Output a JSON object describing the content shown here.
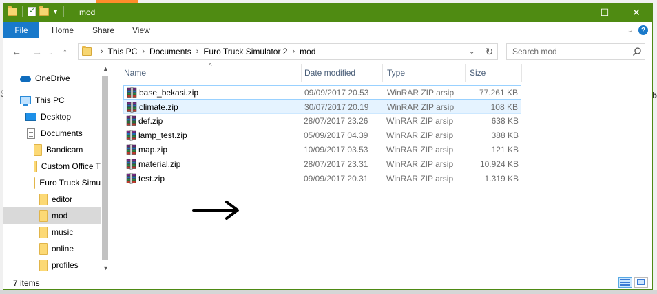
{
  "window": {
    "title": "mod"
  },
  "title_controls": {
    "minimize": "—",
    "maximize": "☐",
    "close": "✕"
  },
  "ribbon": {
    "file": "File",
    "tabs": [
      "Home",
      "Share",
      "View"
    ]
  },
  "nav": {
    "back": "←",
    "forward": "→",
    "up": "↑",
    "breadcrumb": [
      "This PC",
      "Documents",
      "Euro Truck Simulator 2",
      "mod"
    ],
    "refresh": "↻"
  },
  "search": {
    "placeholder": "Search mod"
  },
  "sidebar": {
    "items": [
      {
        "label": "OneDrive",
        "icon": "onedrive-icon"
      },
      {
        "label": "This PC",
        "icon": "computer-icon"
      },
      {
        "label": "Desktop",
        "icon": "desktop-icon"
      },
      {
        "label": "Documents",
        "icon": "documents-icon"
      },
      {
        "label": "Bandicam",
        "icon": "folder-icon"
      },
      {
        "label": "Custom Office T",
        "icon": "folder-icon"
      },
      {
        "label": "Euro Truck Simu",
        "icon": "folder-icon"
      },
      {
        "label": "editor",
        "icon": "folder-icon"
      },
      {
        "label": "mod",
        "icon": "folder-icon",
        "selected": true
      },
      {
        "label": "music",
        "icon": "folder-icon"
      },
      {
        "label": "online",
        "icon": "folder-icon"
      },
      {
        "label": "profiles",
        "icon": "folder-icon"
      }
    ]
  },
  "columns": {
    "name": "Name",
    "date": "Date modified",
    "type": "Type",
    "size": "Size"
  },
  "files": [
    {
      "name": "base_bekasi.zip",
      "date": "09/09/2017 20.53",
      "type": "WinRAR ZIP arsip",
      "size": "77.261 KB",
      "state": "focused"
    },
    {
      "name": "climate.zip",
      "date": "30/07/2017 20.19",
      "type": "WinRAR ZIP arsip",
      "size": "108 KB",
      "state": "hover"
    },
    {
      "name": "def.zip",
      "date": "28/07/2017 23.26",
      "type": "WinRAR ZIP arsip",
      "size": "638 KB"
    },
    {
      "name": "lamp_test.zip",
      "date": "05/09/2017 04.39",
      "type": "WinRAR ZIP arsip",
      "size": "388 KB"
    },
    {
      "name": "map.zip",
      "date": "10/09/2017 03.53",
      "type": "WinRAR ZIP arsip",
      "size": "121 KB"
    },
    {
      "name": "material.zip",
      "date": "28/07/2017 23.31",
      "type": "WinRAR ZIP arsip",
      "size": "10.924 KB"
    },
    {
      "name": "test.zip",
      "date": "09/09/2017 20.31",
      "type": "WinRAR ZIP arsip",
      "size": "1.319 KB"
    }
  ],
  "status": {
    "count": "7 items"
  },
  "colors": {
    "titlebar": "#4f8b12",
    "file_tab": "#1979ca",
    "selection": "#e5f3ff"
  }
}
